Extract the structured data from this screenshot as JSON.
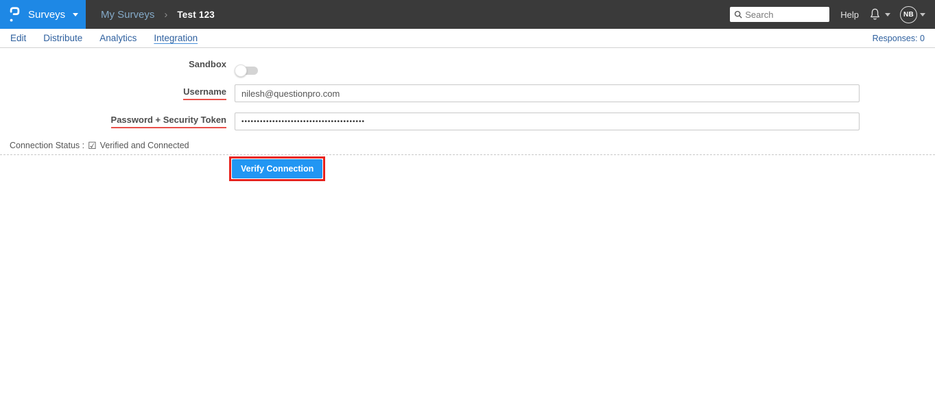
{
  "topbar": {
    "logo_menu": {
      "label": "Surveys"
    },
    "breadcrumb": {
      "parent": "My Surveys",
      "separator": "›",
      "current": "Test 123"
    },
    "search": {
      "placeholder": "Search"
    },
    "help_label": "Help",
    "user": {
      "initials": "NB"
    }
  },
  "tabs": {
    "items": [
      {
        "label": "Edit"
      },
      {
        "label": "Distribute"
      },
      {
        "label": "Analytics"
      },
      {
        "label": "Integration"
      }
    ],
    "active_tab": "Integration",
    "responses": "Responses: 0"
  },
  "form": {
    "sandbox": {
      "label": "Sandbox",
      "state": "off"
    },
    "username": {
      "label": "Username",
      "value": "nilesh@questionpro.com"
    },
    "password": {
      "label": "Password + Security Token",
      "value": "••••••••••••••••••••••••••••••••••••••••"
    },
    "connection_status": {
      "label": "Connection Status :",
      "check_glyph": "☑",
      "value": "Verified and Connected"
    },
    "verify_button": {
      "label": "Verify Connection"
    }
  },
  "colors": {
    "brand_blue": "#1e88e5",
    "topbar_bg": "#3a3a3a",
    "tab_text_blue": "#2d5f9e",
    "active_tab_underline": "#4a90d9",
    "label_underline_red": "#e9504a",
    "button_blue": "#2196f3",
    "annotation_red": "#e8221c"
  }
}
